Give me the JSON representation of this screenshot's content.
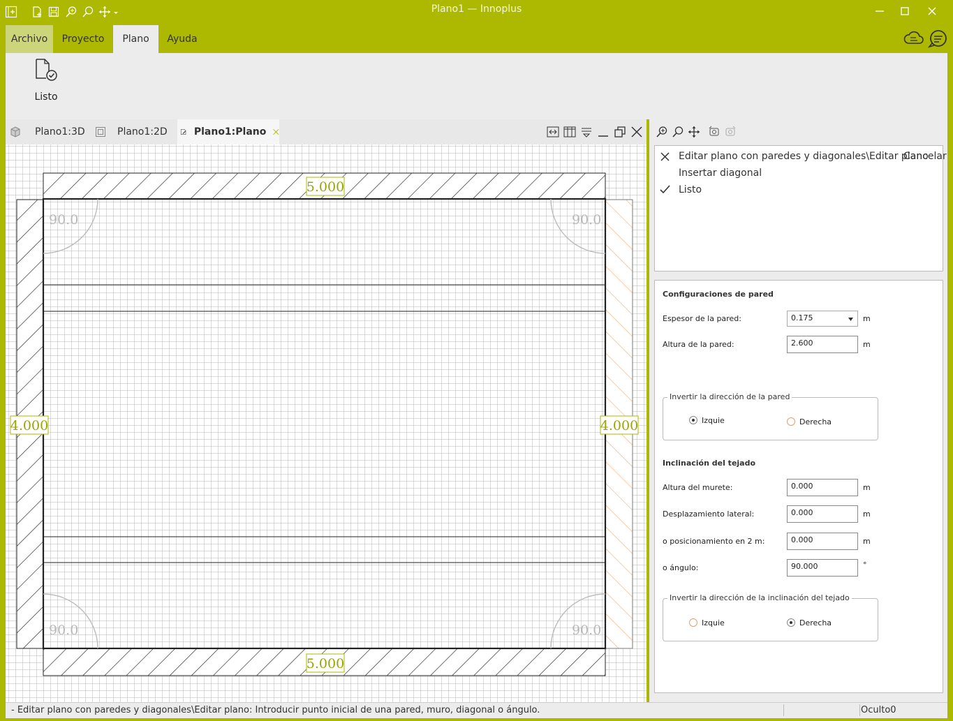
{
  "window": {
    "title": "Plano1 — Innoplus",
    "minimize_glyph": "—",
    "maximize_glyph": "☐",
    "close_glyph": "✕"
  },
  "quick_access": [
    "app-menu-icon",
    "new-file-icon",
    "save-icon",
    "zoom-in-icon",
    "zoom-icon",
    "pan-icon",
    "dropdown-icon"
  ],
  "ribbon_tabs": [
    {
      "label": "Archivo"
    },
    {
      "label": "Proyecto"
    },
    {
      "label": "Plano"
    },
    {
      "label": "Ayuda"
    }
  ],
  "ribbon": {
    "listo_label": "Listo"
  },
  "doc_tabs": [
    {
      "label": "Plano1:3D"
    },
    {
      "label": "Plano1:2D"
    },
    {
      "label": "Plano1:Plano"
    }
  ],
  "plan": {
    "dim_top": "5.000",
    "dim_bottom": "5.000",
    "dim_left": "4.000",
    "dim_right": "4.000",
    "angle_tl": "90.0",
    "angle_tr": "90.0",
    "angle_bl": "90.0",
    "angle_br": "90.0",
    "accent_color": "#adb800",
    "highlight_hatch_color": "#f2b27a"
  },
  "commands": {
    "item1": "Editar plano con paredes y diagonales\\Editar plano",
    "cancel": "Cancelar",
    "item2": "Insertar diagonal",
    "item3": "Listo"
  },
  "settings": {
    "wall_header": "Configuraciones de pared",
    "thickness_label": "Espesor de la pared:",
    "thickness_value": "0.175",
    "height_label": "Altura de la pared:",
    "height_value": "2.600",
    "unit_m": "m",
    "wall_dir_legend": "Invertir la dirección de la pared",
    "left_label": "Izquie",
    "right_label": "Derecha",
    "roof_header": "Inclinación del tejado",
    "kneewall_label": "Altura del murete:",
    "kneewall_value": "0.000",
    "lateral_label": "Desplazamiento lateral:",
    "lateral_value": "0.000",
    "pos2m_label": "o posicionamiento en 2 m:",
    "pos2m_value": "0.000",
    "angle_label": "o ángulo:",
    "angle_value": "90.000",
    "unit_deg": "°",
    "roof_dir_legend": "Invertir la dirección de la inclinación del tejado"
  },
  "status": {
    "message": "- Editar plano con paredes y diagonales\\Editar plano: Introducir punto inicial de una pared, muro, diagonal o ángulo.",
    "right_text": "Oculto0"
  }
}
